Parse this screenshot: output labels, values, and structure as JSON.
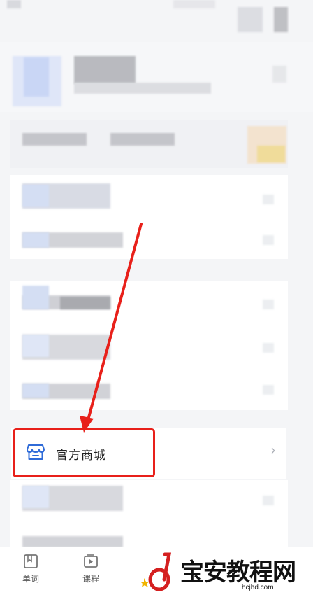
{
  "mall_row": {
    "label": "官方商城",
    "chevron": "›",
    "icon": "storefront-icon"
  },
  "tabs": [
    {
      "label": "单词",
      "icon": "book-icon"
    },
    {
      "label": "课程",
      "icon": "video-icon"
    }
  ],
  "watermark": {
    "text": "宝安教程网",
    "url": "hcjhd.com",
    "logo": "d-logo-icon"
  },
  "colors": {
    "highlight": "#e8201a",
    "accent_blue": "#2f6bd8",
    "background": "#f4f5f7"
  }
}
